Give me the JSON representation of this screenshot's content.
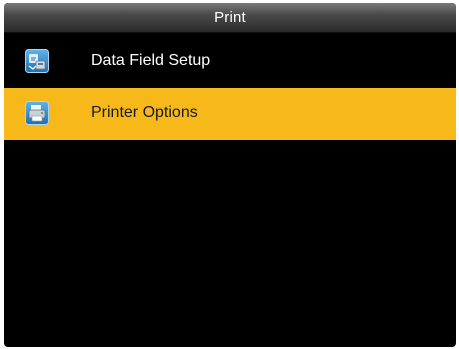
{
  "header": {
    "title": "Print"
  },
  "menu": {
    "items": [
      {
        "label": "Data Field Setup",
        "icon": "data-field-icon",
        "selected": false
      },
      {
        "label": "Printer Options",
        "icon": "printer-icon",
        "selected": true
      }
    ]
  },
  "colors": {
    "background": "#000000",
    "selection": "#f7b81a",
    "icon_tile": "#2f8fcf"
  }
}
